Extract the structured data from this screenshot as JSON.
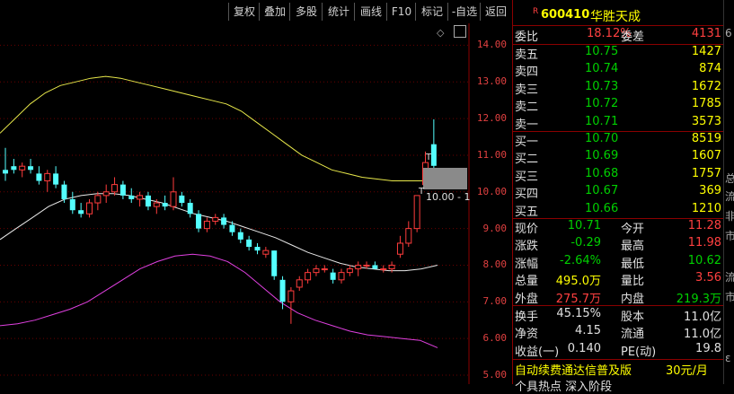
{
  "toolbar": {
    "buttons": [
      "复权",
      "叠加",
      "多股",
      "统计",
      "画线",
      "F10",
      "标记",
      "-自选",
      "返回"
    ]
  },
  "chart": {
    "y_ticks": [
      "14.00",
      "13.00",
      "12.00",
      "11.00",
      "10.00",
      "9.00",
      "8.00",
      "7.00",
      "6.00",
      "5.00"
    ],
    "crosshair_label": "10.00 - 1",
    "marker_t": "T",
    "diamond_icon": "◇"
  },
  "chart_data": {
    "type": "candlestick",
    "ylim": [
      5.0,
      14.5
    ],
    "candles": [
      {
        "o": 10.6,
        "h": 11.2,
        "l": 10.3,
        "c": 10.5
      },
      {
        "o": 10.7,
        "h": 10.9,
        "l": 10.5,
        "c": 10.6
      },
      {
        "o": 10.6,
        "h": 10.8,
        "l": 10.4,
        "c": 10.7
      },
      {
        "o": 10.7,
        "h": 10.9,
        "l": 10.5,
        "c": 10.6
      },
      {
        "o": 10.5,
        "h": 10.7,
        "l": 10.2,
        "c": 10.3
      },
      {
        "o": 10.3,
        "h": 10.6,
        "l": 10.0,
        "c": 10.5
      },
      {
        "o": 10.5,
        "h": 10.7,
        "l": 10.1,
        "c": 10.2
      },
      {
        "o": 10.2,
        "h": 10.3,
        "l": 9.7,
        "c": 9.8
      },
      {
        "o": 9.8,
        "h": 10.0,
        "l": 9.4,
        "c": 9.5
      },
      {
        "o": 9.5,
        "h": 9.7,
        "l": 9.3,
        "c": 9.4
      },
      {
        "o": 9.4,
        "h": 9.8,
        "l": 9.3,
        "c": 9.7
      },
      {
        "o": 9.7,
        "h": 10.0,
        "l": 9.5,
        "c": 9.9
      },
      {
        "o": 9.9,
        "h": 10.2,
        "l": 9.7,
        "c": 10.0
      },
      {
        "o": 10.0,
        "h": 10.4,
        "l": 9.9,
        "c": 10.2
      },
      {
        "o": 10.2,
        "h": 10.3,
        "l": 9.8,
        "c": 9.9
      },
      {
        "o": 9.9,
        "h": 10.1,
        "l": 9.7,
        "c": 9.8
      },
      {
        "o": 9.8,
        "h": 10.0,
        "l": 9.6,
        "c": 9.9
      },
      {
        "o": 9.9,
        "h": 10.0,
        "l": 9.5,
        "c": 9.6
      },
      {
        "o": 9.6,
        "h": 9.8,
        "l": 9.4,
        "c": 9.7
      },
      {
        "o": 9.7,
        "h": 9.9,
        "l": 9.5,
        "c": 9.6
      },
      {
        "o": 9.6,
        "h": 10.4,
        "l": 9.5,
        "c": 10.0
      },
      {
        "o": 9.9,
        "h": 10.0,
        "l": 9.6,
        "c": 9.7
      },
      {
        "o": 9.7,
        "h": 9.8,
        "l": 9.3,
        "c": 9.4
      },
      {
        "o": 9.4,
        "h": 9.5,
        "l": 8.9,
        "c": 9.0
      },
      {
        "o": 9.0,
        "h": 9.3,
        "l": 8.9,
        "c": 9.2
      },
      {
        "o": 9.2,
        "h": 9.4,
        "l": 9.1,
        "c": 9.3
      },
      {
        "o": 9.3,
        "h": 9.4,
        "l": 9.0,
        "c": 9.1
      },
      {
        "o": 9.1,
        "h": 9.2,
        "l": 8.8,
        "c": 8.9
      },
      {
        "o": 8.9,
        "h": 9.0,
        "l": 8.6,
        "c": 8.7
      },
      {
        "o": 8.7,
        "h": 8.8,
        "l": 8.4,
        "c": 8.5
      },
      {
        "o": 8.5,
        "h": 8.6,
        "l": 8.3,
        "c": 8.4
      },
      {
        "o": 8.3,
        "h": 8.5,
        "l": 8.2,
        "c": 8.4
      },
      {
        "o": 8.4,
        "h": 8.4,
        "l": 7.6,
        "c": 7.7
      },
      {
        "o": 7.6,
        "h": 7.7,
        "l": 6.8,
        "c": 7.0
      },
      {
        "o": 7.0,
        "h": 7.4,
        "l": 6.4,
        "c": 7.3
      },
      {
        "o": 7.4,
        "h": 7.7,
        "l": 7.3,
        "c": 7.6
      },
      {
        "o": 7.6,
        "h": 7.9,
        "l": 7.5,
        "c": 7.8
      },
      {
        "o": 7.8,
        "h": 8.0,
        "l": 7.7,
        "c": 7.9
      },
      {
        "o": 7.9,
        "h": 8.0,
        "l": 7.8,
        "c": 7.9
      },
      {
        "o": 7.8,
        "h": 7.9,
        "l": 7.5,
        "c": 7.6
      },
      {
        "o": 7.6,
        "h": 7.9,
        "l": 7.5,
        "c": 7.8
      },
      {
        "o": 7.8,
        "h": 8.0,
        "l": 7.7,
        "c": 7.9
      },
      {
        "o": 7.9,
        "h": 8.1,
        "l": 7.7,
        "c": 8.0
      },
      {
        "o": 8.0,
        "h": 8.1,
        "l": 7.9,
        "c": 8.0
      },
      {
        "o": 8.0,
        "h": 8.1,
        "l": 7.9,
        "c": 7.9
      },
      {
        "o": 7.9,
        "h": 8.0,
        "l": 7.8,
        "c": 7.9
      },
      {
        "o": 7.9,
        "h": 8.1,
        "l": 7.8,
        "c": 8.0
      },
      {
        "o": 8.3,
        "h": 8.8,
        "l": 8.2,
        "c": 8.6
      },
      {
        "o": 8.6,
        "h": 9.2,
        "l": 8.5,
        "c": 9.0
      },
      {
        "o": 9.0,
        "h": 9.4,
        "l": 8.9,
        "c": 9.9
      },
      {
        "o": 10.2,
        "h": 11.1,
        "l": 10.1,
        "c": 10.8
      },
      {
        "o": 11.3,
        "h": 11.98,
        "l": 10.62,
        "c": 10.71
      }
    ],
    "upper_band": [
      11.6,
      12.0,
      12.4,
      12.7,
      12.9,
      13.0,
      13.1,
      13.15,
      13.1,
      13.0,
      12.9,
      12.8,
      12.7,
      12.6,
      12.5,
      12.4,
      12.2,
      11.9,
      11.6,
      11.3,
      11.0,
      10.8,
      10.6,
      10.5,
      10.4,
      10.35,
      10.3,
      10.3,
      10.3,
      10.3
    ],
    "mid_band": [
      8.7,
      9.0,
      9.3,
      9.6,
      9.8,
      9.9,
      9.95,
      9.95,
      9.9,
      9.8,
      9.7,
      9.55,
      9.4,
      9.3,
      9.2,
      9.05,
      8.9,
      8.75,
      8.55,
      8.35,
      8.2,
      8.05,
      7.95,
      7.9,
      7.85,
      7.85,
      7.9,
      8.0
    ],
    "lower_band": [
      6.35,
      6.4,
      6.5,
      6.65,
      6.8,
      7.0,
      7.3,
      7.6,
      7.9,
      8.1,
      8.25,
      8.3,
      8.25,
      8.1,
      7.8,
      7.4,
      7.0,
      6.7,
      6.5,
      6.35,
      6.2,
      6.1,
      6.05,
      6.0,
      5.95,
      5.75
    ]
  },
  "quote": {
    "badge": "R",
    "code": "600410",
    "name": "华胜天成",
    "weibi_label": "委比",
    "weibi_value": "18.12%",
    "weicha_label": "委差",
    "weicha_value": "4131",
    "sells": [
      {
        "label": "卖五",
        "price": "10.75",
        "vol": "1427"
      },
      {
        "label": "卖四",
        "price": "10.74",
        "vol": "874"
      },
      {
        "label": "卖三",
        "price": "10.73",
        "vol": "1672"
      },
      {
        "label": "卖二",
        "price": "10.72",
        "vol": "1785"
      },
      {
        "label": "卖一",
        "price": "10.71",
        "vol": "3573"
      }
    ],
    "buys": [
      {
        "label": "买一",
        "price": "10.70",
        "vol": "8519"
      },
      {
        "label": "买二",
        "price": "10.69",
        "vol": "1607"
      },
      {
        "label": "买三",
        "price": "10.68",
        "vol": "1757"
      },
      {
        "label": "买四",
        "price": "10.67",
        "vol": "369"
      },
      {
        "label": "买五",
        "price": "10.66",
        "vol": "1210"
      }
    ],
    "stats": [
      {
        "l1": "现价",
        "v1": "10.71",
        "c1": "green",
        "l2": "今开",
        "v2": "11.28",
        "c2": "red"
      },
      {
        "l1": "涨跌",
        "v1": "-0.29",
        "c1": "green",
        "l2": "最高",
        "v2": "11.98",
        "c2": "red"
      },
      {
        "l1": "涨幅",
        "v1": "-2.64%",
        "c1": "green",
        "l2": "最低",
        "v2": "10.62",
        "c2": "green"
      },
      {
        "l1": "总量",
        "v1": "495.0万",
        "c1": "yellow",
        "l2": "量比",
        "v2": "3.56",
        "c2": "red"
      },
      {
        "l1": "外盘",
        "v1": "275.7万",
        "c1": "red",
        "l2": "内盘",
        "v2": "219.3万",
        "c2": "green"
      }
    ],
    "finance": [
      {
        "l1": "换手",
        "v1": "45.15%",
        "l2": "股本",
        "v2": "11.0亿"
      },
      {
        "l1": "净资",
        "v1": "4.15",
        "l2": "流通",
        "v2": "11.0亿"
      },
      {
        "l1": "收益(一)",
        "v1": "0.140",
        "l2": "PE(动)",
        "v2": "19.8"
      }
    ],
    "ad_text": "自动续费通达信普及版",
    "ad_price": "30元/月",
    "cut_text": "个具热点 深入阶段"
  },
  "right_strip": [
    "6",
    "总",
    "流",
    "非",
    "市",
    "流",
    "市",
    "ε"
  ]
}
